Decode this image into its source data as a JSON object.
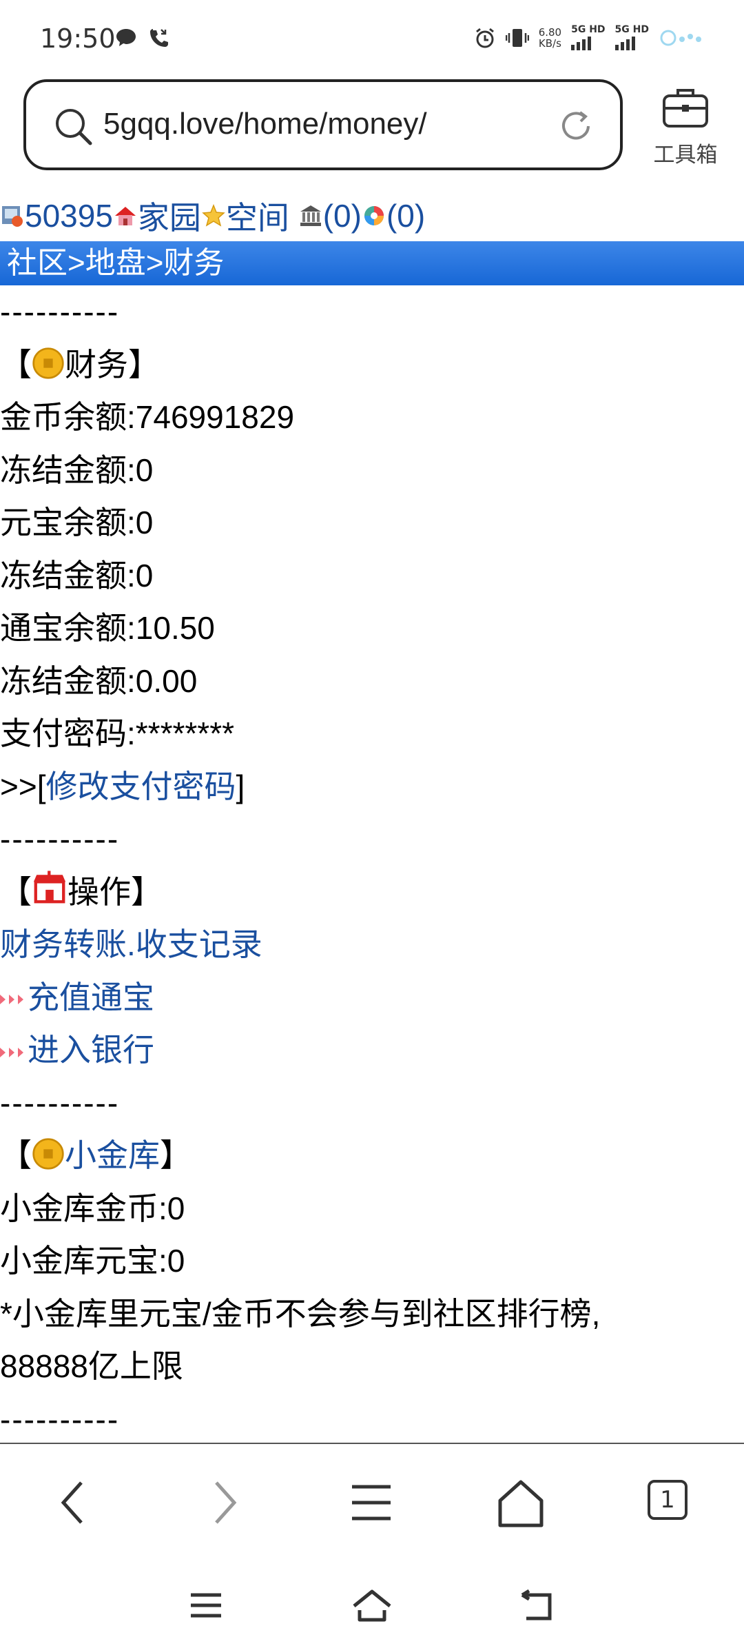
{
  "status_bar": {
    "time": "19:50",
    "speed_value": "6.80",
    "speed_unit": "KB/s",
    "net1": "5G HD",
    "net2": "5G HD"
  },
  "address_bar": {
    "url": "5gqq.love/home/money/",
    "toolbox_label": "工具箱"
  },
  "topnav": {
    "user_id": "50395",
    "home": "家园",
    "space": "空间",
    "bank_count": "(0)",
    "color_count": "(0)"
  },
  "breadcrumb": {
    "community": "社区",
    "sep1": ">",
    "territory": "地盘",
    "sep2": ">",
    "finance": "财务"
  },
  "divider": "----------",
  "finance_section": {
    "open": "【",
    "title": "财务",
    "close": "】",
    "gold_balance": "金币余额:746991829",
    "frozen1": "冻结金额:0",
    "yuanbao_balance": "元宝余额:0",
    "frozen2": "冻结金额:0",
    "tongbao_balance": "通宝余额:10.50",
    "frozen3": "冻结金额:0.00",
    "pay_password": "支付密码:********",
    "modify_prefix": ">>[",
    "modify_link": "修改支付密码",
    "modify_suffix": "]"
  },
  "operation_section": {
    "open": "【",
    "title": "操作",
    "close": "】",
    "transfer_link": "财务转账.",
    "records_link": "收支记录",
    "recharge_link": "充值通宝",
    "bank_link": "进入银行"
  },
  "vault_section": {
    "open": "【",
    "title_link": "小金库",
    "close": "】",
    "vault_gold": "小金库金币:0",
    "vault_yuanbao": "小金库元宝:0",
    "note1": "*小金库里元宝/金币不会参与到社区排行榜,",
    "note2": "88888亿上限"
  },
  "bottom_nav": {
    "tab_count": "1"
  },
  "colors": {
    "link": "#1a4f9f",
    "breadcrumb_bg": "#2a77e0"
  }
}
